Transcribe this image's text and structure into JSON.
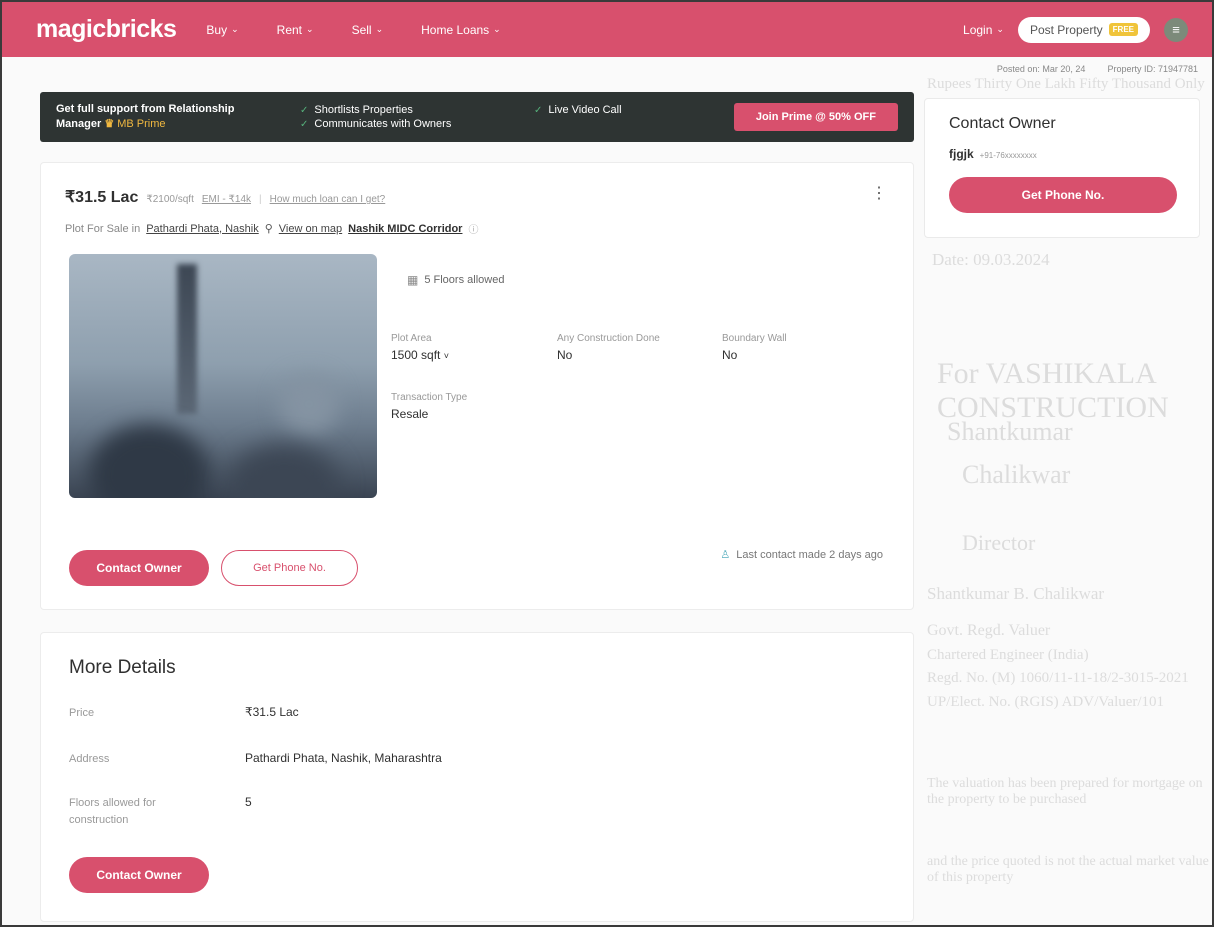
{
  "header": {
    "logo": "magicbricks",
    "nav": [
      "Buy",
      "Rent",
      "Sell",
      "Home Loans"
    ],
    "login": "Login",
    "post_property": "Post Property",
    "free_badge": "FREE"
  },
  "posted": {
    "date": "Posted on: Mar 20, 24",
    "property_id": "Property ID: 71947781"
  },
  "prime_banner": {
    "line1": "Get full support from Relationship",
    "line2_prefix": "Manager",
    "line2_brand": "MB Prime",
    "features": [
      "Shortlists Properties",
      "Live Video Call",
      "Communicates with Owners"
    ],
    "cta": "Join Prime @ 50% OFF"
  },
  "contact_card": {
    "title": "Contact Owner",
    "name": "fjgjk",
    "phone": "+91-76xxxxxxxx",
    "button": "Get Phone No."
  },
  "listing": {
    "price": "₹31.5 Lac",
    "price_per_sqft": "₹2100/sqft",
    "emi": "EMI - ₹14k",
    "loan_link": "How much loan can I get?",
    "location_prefix": "Plot For Sale in",
    "locality": "Pathardi Phata, Nashik",
    "map_link": "View on map",
    "corridor": "Nashik MIDC Corridor",
    "floors_allowed": "5 Floors allowed",
    "attributes": [
      {
        "label": "Plot Area",
        "value": "1500 sqft"
      },
      {
        "label": "Any Construction Done",
        "value": "No"
      },
      {
        "label": "Boundary Wall",
        "value": "No"
      },
      {
        "label": "Transaction Type",
        "value": "Resale"
      }
    ],
    "contact_button": "Contact Owner",
    "phone_button": "Get Phone No.",
    "last_contact": "Last contact made 2 days ago"
  },
  "more_details": {
    "title": "More Details",
    "rows": [
      {
        "key": "Price",
        "value": "₹31.5 Lac"
      },
      {
        "key": "Address",
        "value": "Pathardi Phata, Nashik, Maharashtra"
      },
      {
        "key": "Floors allowed for construction",
        "value": "5"
      }
    ],
    "contact_button": "Contact Owner"
  },
  "background_text": {
    "top": "Rupees Thirty One Lakh Fifty Thousand Only",
    "date": "Date: 09.03.2024",
    "company": "For VASHIKALA CONSTRUCTION",
    "name1": "Shantkumar",
    "name2": "Chalikwar",
    "role": "Director",
    "sign_name": "Shantkumar B. Chalikwar",
    "line1": "Govt. Regd. Valuer",
    "line2": "Chartered Engineer (India)",
    "line3": "Regd. No. (M) 1060/11-11-18/2-3015-2021",
    "line4": "UP/Elect. No. (RGIS) ADV/Valuer/101",
    "line5": "The valuation has been prepared for mortgage on the property to be purchased",
    "line6": "and the price quoted is not the actual market value of this property"
  }
}
